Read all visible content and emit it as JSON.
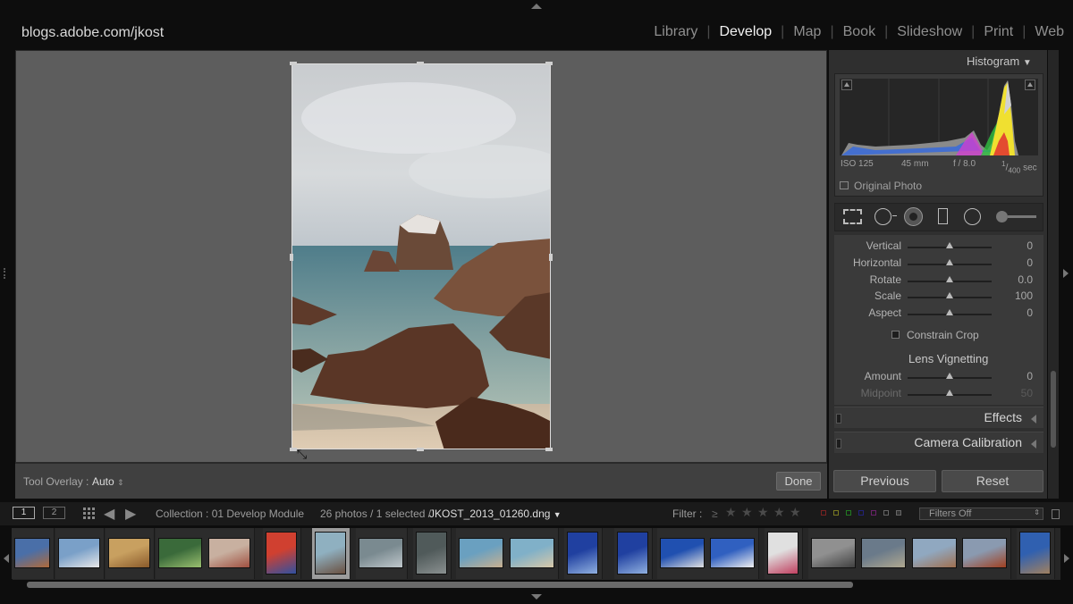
{
  "site_title": "blogs.adobe.com/jkost",
  "modules": [
    {
      "label": "Library",
      "active": false
    },
    {
      "label": "Develop",
      "active": true
    },
    {
      "label": "Map",
      "active": false
    },
    {
      "label": "Book",
      "active": false
    },
    {
      "label": "Slideshow",
      "active": false
    },
    {
      "label": "Print",
      "active": false
    },
    {
      "label": "Web",
      "active": false
    }
  ],
  "toolbar": {
    "overlay_label": "Tool Overlay :",
    "overlay_value": "Auto",
    "done_label": "Done"
  },
  "histogram": {
    "title": "Histogram",
    "iso": "ISO 125",
    "focal": "45 mm",
    "aperture": "f / 8.0",
    "shutter_num": "1",
    "shutter_den": "400",
    "shutter_unit": "sec",
    "original_photo": "Original Photo"
  },
  "sliders": [
    {
      "label": "Vertical",
      "value": "0",
      "pos": 0.5
    },
    {
      "label": "Horizontal",
      "value": "0",
      "pos": 0.5
    },
    {
      "label": "Rotate",
      "value": "0.0",
      "pos": 0.5
    },
    {
      "label": "Scale",
      "value": "100",
      "pos": 0.5
    },
    {
      "label": "Aspect",
      "value": "0",
      "pos": 0.5
    }
  ],
  "constrain_crop": "Constrain Crop",
  "lens_vignetting": {
    "title": "Lens Vignetting",
    "sliders": [
      {
        "label": "Amount",
        "value": "0",
        "pos": 0.5
      },
      {
        "label": "Midpoint",
        "value": "50",
        "pos": 0.5
      }
    ]
  },
  "sections": [
    "Effects",
    "Camera Calibration"
  ],
  "buttons": {
    "previous": "Previous",
    "reset": "Reset"
  },
  "filmbar": {
    "view1": "1",
    "view2": "2",
    "collection": "Collection : 01 Develop Module",
    "count": "26 photos / 1 selected /",
    "filename": "JKOST_2013_01260.dng",
    "filter_label": "Filter :",
    "filter_op": "≥",
    "filters_off": "Filters Off"
  },
  "colors": {
    "accent": "#f2f2f2",
    "panel": "#2f2f2f",
    "canvas": "#5d5d5d"
  },
  "thumbnails": [
    {
      "c1": "#4a6fa8",
      "c2": "#b06a3a"
    },
    {
      "c1": "#7aa0c8",
      "c2": "#e8e8e8"
    },
    {
      "c1": "#c8a060",
      "c2": "#8a5a2a"
    },
    {
      "c1": "#3a6a3a",
      "c2": "#9ac070"
    },
    {
      "c1": "#c8b0a0",
      "c2": "#a05040"
    },
    {
      "c1": "#d04030",
      "c2": "#3050a0"
    },
    {
      "c1": "#8fb0c0",
      "c2": "#6a5040"
    },
    {
      "c1": "#7a8a90",
      "c2": "#c0c8cc"
    },
    {
      "c1": "#505a5a",
      "c2": "#8a9090"
    },
    {
      "c1": "#6aa0c0",
      "c2": "#c8b090"
    },
    {
      "c1": "#80b0c8",
      "c2": "#d8c8a8"
    },
    {
      "c1": "#2040a0",
      "c2": "#90b0e0"
    },
    {
      "c1": "#2040a0",
      "c2": "#90b0e0"
    },
    {
      "c1": "#2050b0",
      "c2": "#e0e0e0"
    },
    {
      "c1": "#3060c0",
      "c2": "#f0f0f0"
    },
    {
      "c1": "#e0e0e0",
      "c2": "#c04060"
    },
    {
      "c1": "#909090",
      "c2": "#404040"
    },
    {
      "c1": "#6a7a8a",
      "c2": "#b0a890"
    },
    {
      "c1": "#90a8c0",
      "c2": "#a07050"
    },
    {
      "c1": "#8a9ab0",
      "c2": "#a04020"
    },
    {
      "c1": "#3060b0",
      "c2": "#a08060"
    }
  ]
}
